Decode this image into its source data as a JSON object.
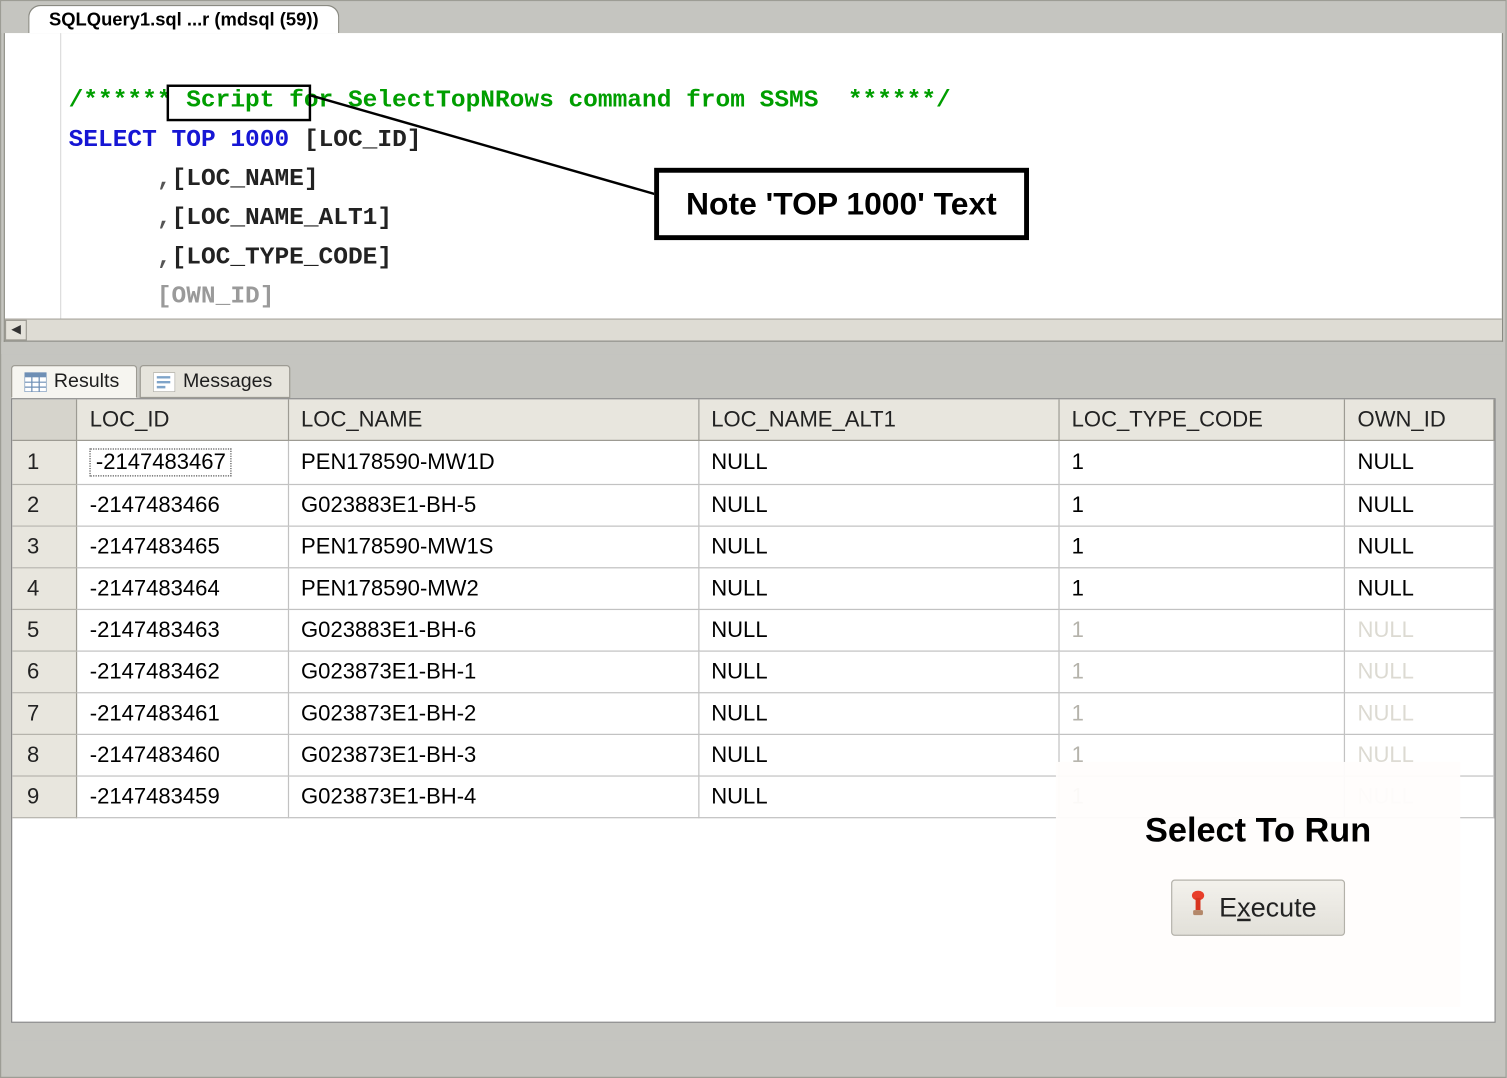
{
  "file_tab": "SQLQuery1.sql ...r (mdsql (59))",
  "sql": {
    "comment": "/****** Script for SelectTopNRows command from SSMS  ******/",
    "select_kw": "SELECT",
    "top_kw": "TOP 1000",
    "col1": "[LOC_ID]",
    "comma": ",",
    "col2": "[LOC_NAME]",
    "col3": "[LOC_NAME_ALT1]",
    "col4": "[LOC_TYPE_CODE]",
    "col5_partial": "[OWN_ID]"
  },
  "callout": {
    "text": "Note 'TOP 1000' Text"
  },
  "results_tabs": {
    "results": "Results",
    "messages": "Messages"
  },
  "columns": [
    "LOC_ID",
    "LOC_NAME",
    "LOC_NAME_ALT1",
    "LOC_TYPE_CODE",
    "OWN_ID"
  ],
  "rows": [
    {
      "n": "1",
      "LOC_ID": "-2147483467",
      "LOC_NAME": "PEN178590-MW1D",
      "LOC_NAME_ALT1": "NULL",
      "LOC_TYPE_CODE": "1",
      "OWN_ID": "NULL"
    },
    {
      "n": "2",
      "LOC_ID": "-2147483466",
      "LOC_NAME": "G023883E1-BH-5",
      "LOC_NAME_ALT1": "NULL",
      "LOC_TYPE_CODE": "1",
      "OWN_ID": "NULL"
    },
    {
      "n": "3",
      "LOC_ID": "-2147483465",
      "LOC_NAME": "PEN178590-MW1S",
      "LOC_NAME_ALT1": "NULL",
      "LOC_TYPE_CODE": "1",
      "OWN_ID": "NULL"
    },
    {
      "n": "4",
      "LOC_ID": "-2147483464",
      "LOC_NAME": "PEN178590-MW2",
      "LOC_NAME_ALT1": "NULL",
      "LOC_TYPE_CODE": "1",
      "OWN_ID": "NULL"
    },
    {
      "n": "5",
      "LOC_ID": "-2147483463",
      "LOC_NAME": "G023883E1-BH-6",
      "LOC_NAME_ALT1": "NULL",
      "LOC_TYPE_CODE": "1",
      "OWN_ID": "NULL"
    },
    {
      "n": "6",
      "LOC_ID": "-2147483462",
      "LOC_NAME": "G023873E1-BH-1",
      "LOC_NAME_ALT1": "NULL",
      "LOC_TYPE_CODE": "1",
      "OWN_ID": "NULL"
    },
    {
      "n": "7",
      "LOC_ID": "-2147483461",
      "LOC_NAME": "G023873E1-BH-2",
      "LOC_NAME_ALT1": "NULL",
      "LOC_TYPE_CODE": "1",
      "OWN_ID": "NULL"
    },
    {
      "n": "8",
      "LOC_ID": "-2147483460",
      "LOC_NAME": "G023873E1-BH-3",
      "LOC_NAME_ALT1": "NULL",
      "LOC_TYPE_CODE": "1",
      "OWN_ID": "NULL"
    },
    {
      "n": "9",
      "LOC_ID": "-2147483459",
      "LOC_NAME": "G023873E1-BH-4",
      "LOC_NAME_ALT1": "NULL",
      "LOC_TYPE_CODE": "1",
      "OWN_ID": "NULL"
    }
  ],
  "overlay": {
    "caption": "Select To Run",
    "exec_pre": "E",
    "exec_under": "x",
    "exec_post": "ecute"
  }
}
